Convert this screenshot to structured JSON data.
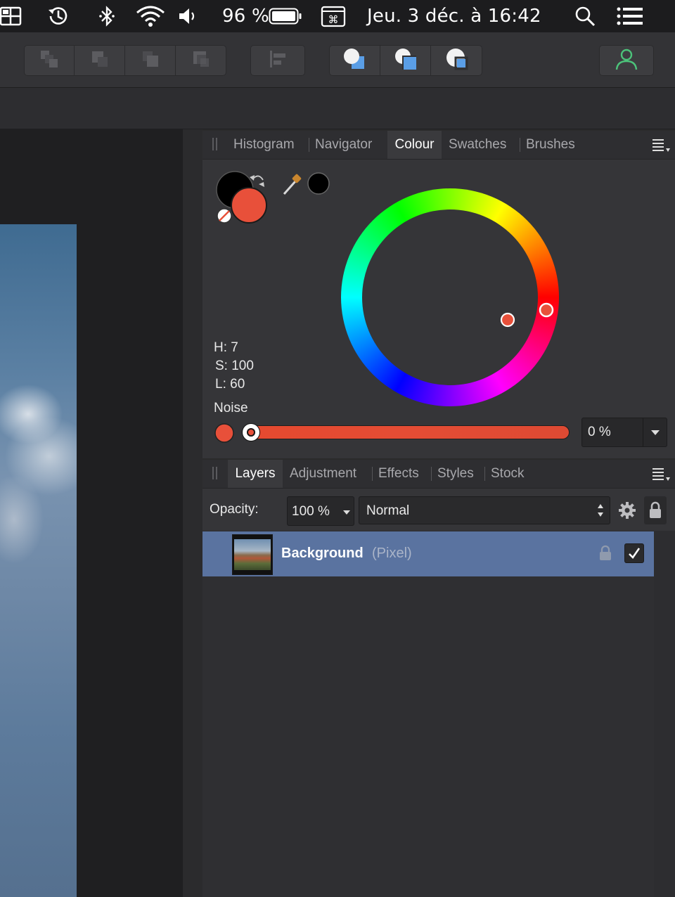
{
  "menubar": {
    "battery_percent": "96 %",
    "datetime": "Jeu. 3 déc. à  16:42",
    "icons": [
      "app-icon",
      "time-machine-icon",
      "bluetooth-icon",
      "wifi-icon",
      "volume-icon",
      "battery-icon",
      "keyboard-viewer-icon",
      "spotlight-icon",
      "notification-center-icon"
    ]
  },
  "toolbar": {
    "groups": [
      {
        "name": "arrange",
        "buttons": [
          "move-to-back-icon",
          "move-back-one-icon",
          "move-forward-one-icon",
          "move-to-front-icon"
        ]
      },
      {
        "name": "align",
        "buttons": [
          "align-icon"
        ]
      },
      {
        "name": "boolean",
        "buttons": [
          "add-shapes-icon",
          "subtract-shapes-icon",
          "intersect-shapes-icon"
        ]
      },
      {
        "name": "persona",
        "buttons": [
          "user-icon"
        ]
      }
    ],
    "accent_color": "#5a9ee6",
    "user_icon_color": "#4cc37a"
  },
  "colour_panel": {
    "tabs": [
      {
        "label": "Histogram",
        "active": false
      },
      {
        "label": "Navigator",
        "active": false
      },
      {
        "label": "Colour",
        "active": true
      },
      {
        "label": "Swatches",
        "active": false
      },
      {
        "label": "Brushes",
        "active": false
      }
    ],
    "fill_color": "#e8503a",
    "stroke_color": "#000000",
    "picked_color": "#000000",
    "h": "H: 7",
    "s": "S: 100",
    "l": "L: 60",
    "noise_label": "Noise",
    "noise_value": "0 %",
    "noise_fraction": 0
  },
  "layers_panel": {
    "tabs": [
      {
        "label": "Layers",
        "active": true
      },
      {
        "label": "Adjustment",
        "active": false
      },
      {
        "label": "Effects",
        "active": false
      },
      {
        "label": "Styles",
        "active": false
      },
      {
        "label": "Stock",
        "active": false
      }
    ],
    "opacity_label": "Opacity:",
    "opacity_value": "100 %",
    "blend_mode": "Normal",
    "layers": [
      {
        "name": "Background",
        "type": "(Pixel)",
        "visible": true,
        "locked": true,
        "selected": true
      }
    ],
    "selection_color": "#5a73a0"
  }
}
